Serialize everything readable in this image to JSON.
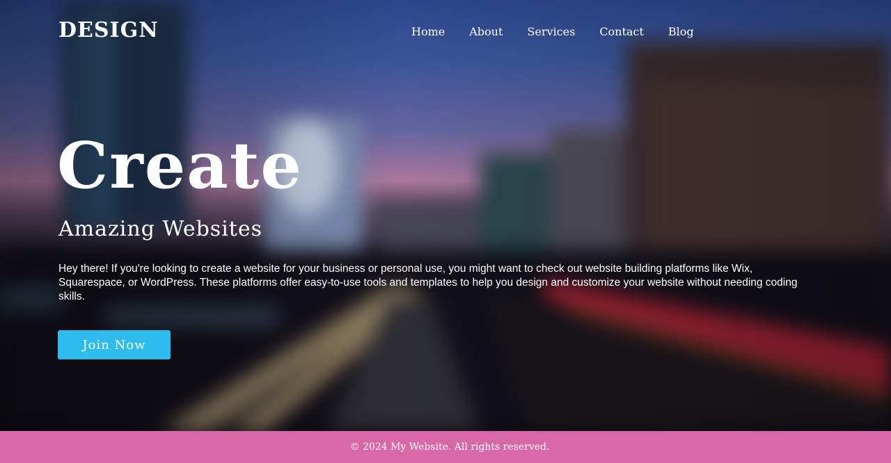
{
  "header": {
    "logo": "DESIGN",
    "nav": [
      {
        "label": "Home"
      },
      {
        "label": "About"
      },
      {
        "label": "Services"
      },
      {
        "label": "Contact"
      },
      {
        "label": "Blog"
      }
    ]
  },
  "hero": {
    "title": "Create",
    "subtitle": "Amazing Websites",
    "text": "Hey there! If you're looking to create a website for your business or personal use, you might want to check out website building platforms like Wix, Squarespace, or WordPress. These platforms offer easy-to-use tools and templates to help you design and customize your website without needing coding skills.",
    "button_label": "Join Now"
  },
  "footer": {
    "text": "© 2024 My Website. All rights reserved."
  },
  "colors": {
    "button": "#2dbceb",
    "footer": "#d867a8",
    "text": "#ffffff"
  }
}
